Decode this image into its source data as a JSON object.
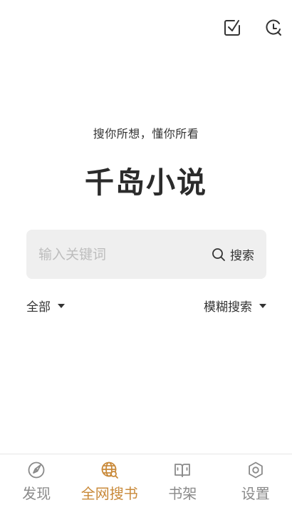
{
  "toolbar": {
    "import_icon": "import-book-icon",
    "history_icon": "history-clock-icon"
  },
  "hero": {
    "slogan": "搜你所想，懂你所看",
    "title": "千岛小说"
  },
  "search": {
    "placeholder": "输入关键词",
    "value": "",
    "button_label": "搜索",
    "button_icon": "search-icon"
  },
  "filters": {
    "scope_label": "全部",
    "mode_label": "模糊搜索"
  },
  "tabbar": {
    "active_color": "#c98a3a",
    "inactive_color": "#8a8a8a",
    "items": [
      {
        "label": "发现",
        "icon": "compass-icon"
      },
      {
        "label": "全网搜书",
        "icon": "globe-search-icon"
      },
      {
        "label": "书架",
        "icon": "book-icon"
      },
      {
        "label": "设置",
        "icon": "gear-icon"
      }
    ]
  }
}
